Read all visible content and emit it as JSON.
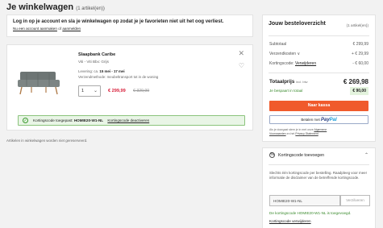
{
  "header": {
    "title": "Je winkelwagen",
    "count": "(1 artikel(en))"
  },
  "login": {
    "line1": "Log in op je account en sla je winkelwagen op zodat je je favorieten niet uit het oog verliest.",
    "create_link": "Nu een account aanmaken",
    "or_text": "of",
    "login_link": "aanmelden"
  },
  "product": {
    "name": "Slaapbank Caribe",
    "variant": "Viti - Viti Bbx: Grijs",
    "delivery_prefix": "Levering: ca.",
    "delivery_range": "15 mei - 17 mei",
    "shipping": "Verzendmethode: meubeltransport tot in de woning",
    "quantity": "1",
    "price_new": "€ 299,99",
    "price_old": "€ 329,99"
  },
  "coupon_bar": {
    "text": "Kortingscode toegepast:",
    "code": "HOMIE20-W1-NL",
    "link": "Kortingscode deactiveren"
  },
  "note": "Artikelen in winkelwagen worden niet gereserveerd.",
  "summary": {
    "title": "Jouw besteloverzicht",
    "count": "(1 artikel(en))",
    "subtotal_label": "Subtotaal",
    "subtotal_value": "€ 299,99",
    "shipping_label": "Verzendkosten ∨",
    "shipping_value": "+ € 29,99",
    "discount_label": "Kortingscode:",
    "discount_link": "Verwijderen",
    "discount_value": "- € 60,00",
    "total_label": "Totaalprijs",
    "total_sub": "incl. btw",
    "total_value": "€ 269,98",
    "saved_label": "Je bespaart in totaal",
    "saved_value": "€ 90,00",
    "order_button": "Naar kassa",
    "paypal_prefix": "Betalen met",
    "paypal_pay": "Pay",
    "paypal_pal": "Pal",
    "terms_line1": "Als je doorgaat stem je in met onze",
    "terms_link1": "Algemene",
    "terms_line2_link": "Voorwaarden",
    "terms_line2_mid": "en het",
    "terms_link2": "Privacy Statement"
  },
  "discount_panel": {
    "title": "Kortingscode toevoegen",
    "info": "Slechts één kortingscode per bestelling. Raadpleeg voor meer informatie de disclaimer van de betreffende kortingscode.",
    "input_value": "HOMIE20-W1-NL",
    "apply_button": "Verzilveren",
    "success": "De kortingscode HOMIE20-W1-NL is toegevoegd.",
    "remove_link": "Kortingscode verwijderen"
  }
}
